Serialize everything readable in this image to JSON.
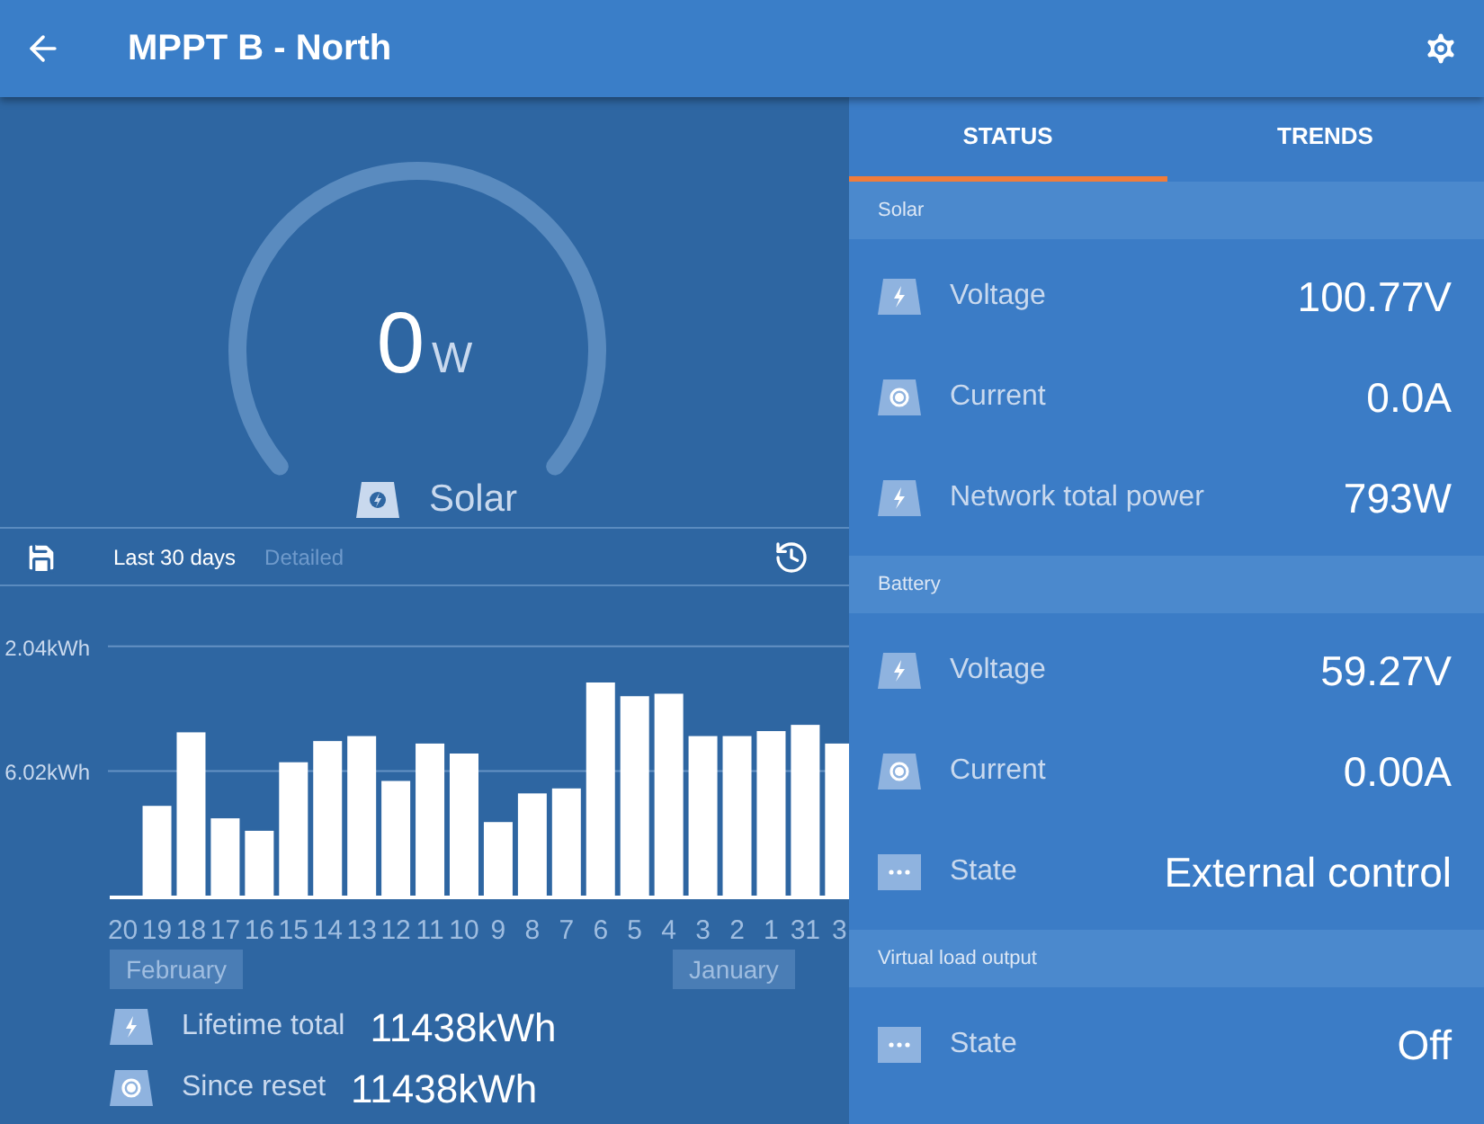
{
  "header": {
    "title": "MPPT B - North"
  },
  "gauge": {
    "value": "0",
    "unit": "W",
    "label": "Solar"
  },
  "toolbar": {
    "options": [
      {
        "label": "Last 30 days",
        "selected": true
      },
      {
        "label": "Detailed",
        "selected": false
      }
    ]
  },
  "chart": {
    "y_labels": [
      "2.04kWh",
      "6.02kWh"
    ],
    "x_labels": [
      "20",
      "19",
      "18",
      "17",
      "16",
      "15",
      "14",
      "13",
      "12",
      "11",
      "10",
      "9",
      "8",
      "7",
      "6",
      "5",
      "4",
      "3",
      "2",
      "1",
      "31",
      "3"
    ]
  },
  "months": [
    "February",
    "January"
  ],
  "totals": [
    {
      "kind": "power",
      "label": "Lifetime total",
      "value": "11438kWh"
    },
    {
      "kind": "current",
      "label": "Since reset",
      "value": "11438kWh"
    }
  ],
  "tabs": [
    {
      "label": "STATUS",
      "selected": true
    },
    {
      "label": "TRENDS",
      "selected": false
    }
  ],
  "sections": [
    {
      "title": "Solar",
      "rows": [
        {
          "kind": "power",
          "label": "Voltage",
          "value": "100.77V"
        },
        {
          "kind": "current",
          "label": "Current",
          "value": "0.0A"
        },
        {
          "kind": "power",
          "label": "Network total power",
          "value": "793W"
        }
      ]
    },
    {
      "title": "Battery",
      "rows": [
        {
          "kind": "power",
          "label": "Voltage",
          "value": "59.27V"
        },
        {
          "kind": "current",
          "label": "Current",
          "value": "0.00A"
        },
        {
          "kind": "state",
          "label": "State",
          "value": "External control"
        }
      ]
    },
    {
      "title": "Virtual load output",
      "rows": [
        {
          "kind": "state",
          "label": "State",
          "value": "Off"
        }
      ]
    }
  ]
}
